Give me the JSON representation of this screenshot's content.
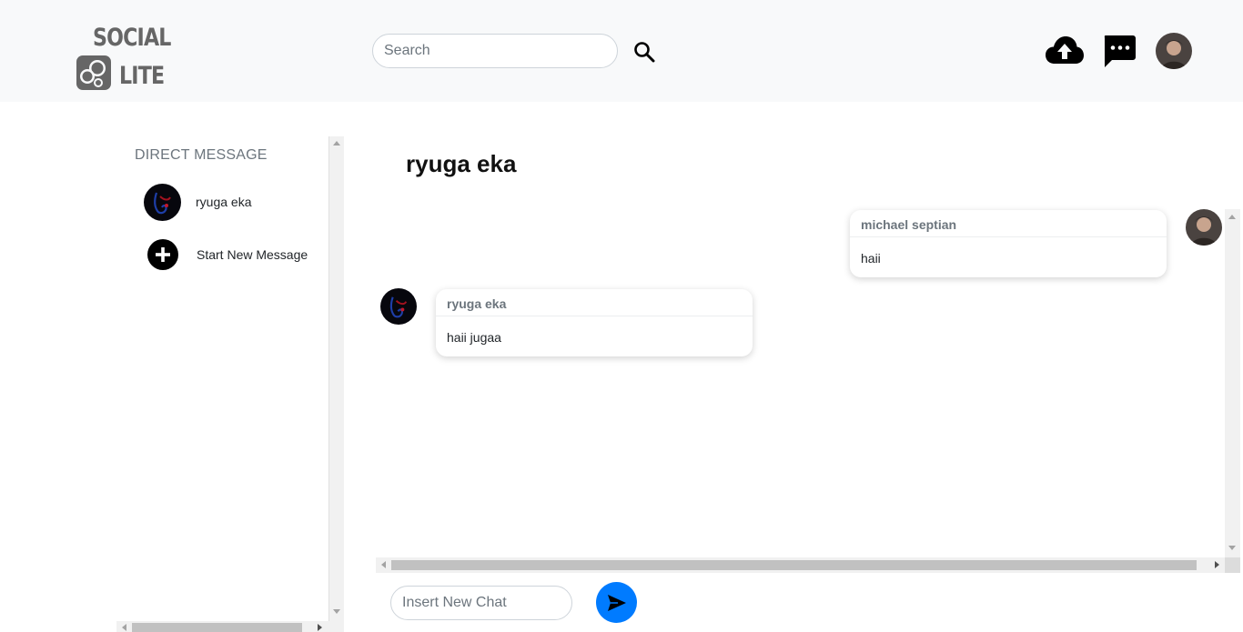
{
  "header": {
    "logo_top": "SOCIAL",
    "logo_bottom": "LITE",
    "search_placeholder": "Search",
    "icons": {
      "search": "search-icon",
      "upload": "cloud-upload-icon",
      "messages": "chat-bubble-icon",
      "profile": "profile-avatar"
    }
  },
  "sidebar": {
    "title": "DIRECT MESSAGE",
    "items": [
      {
        "label": "ryuga eka",
        "icon": "contact-avatar"
      },
      {
        "label": "Start New Message",
        "icon": "plus-circle-icon"
      }
    ]
  },
  "chat": {
    "title": "ryuga eka",
    "messages": [
      {
        "sender": "michael septian",
        "text": "haii",
        "side": "right"
      },
      {
        "sender": "ryuga eka",
        "text": "haii jugaa",
        "side": "left"
      }
    ],
    "input_placeholder": "Insert New Chat",
    "send_icon": "send-icon"
  },
  "colors": {
    "header_bg": "#f8f9fa",
    "accent": "#007bff",
    "muted_text": "#6c757d"
  }
}
